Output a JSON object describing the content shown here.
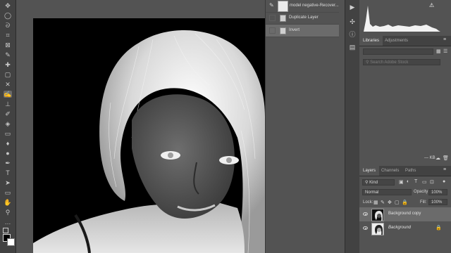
{
  "history": {
    "snapshot_label": "model negative-Recover...",
    "items": [
      {
        "label": "Duplicate Layer"
      },
      {
        "label": "Invert"
      }
    ]
  },
  "panels": {
    "library_tabs": [
      "Libraries",
      "Adjustments"
    ],
    "library_search_placeholder": "Search Adobe Stock",
    "library_size": "— KB",
    "layers_tabs": [
      "Layers",
      "Channels",
      "Paths"
    ],
    "kind_filter": "Kind",
    "blend_mode": "Normal",
    "opacity_label": "Opacity:",
    "opacity_value": "100%",
    "lock_label": "Lock:",
    "fill_label": "Fill:",
    "fill_value": "100%",
    "layers": [
      {
        "name": "Background copy",
        "visible": true,
        "selected": true
      },
      {
        "name": "Background",
        "visible": true,
        "selected": false,
        "locked": true
      }
    ]
  },
  "toolbar": {
    "tools": [
      "move-icon",
      "marquee-icon",
      "lasso-icon",
      "magic-wand-icon",
      "crop-icon",
      "eyedropper-icon",
      "healing-icon",
      "brush-icon",
      "stamp-icon",
      "history-brush-icon",
      "eraser-icon",
      "gradient-icon",
      "blur-icon",
      "dodge-icon",
      "pen-icon",
      "type-icon",
      "path-select-icon",
      "shape-icon",
      "hand-icon",
      "zoom-icon"
    ]
  },
  "colors": {
    "ui_dark": "#424242",
    "ui_mid": "#535353",
    "selected_row": "#6b6b6b",
    "warning": "#ffffff"
  }
}
